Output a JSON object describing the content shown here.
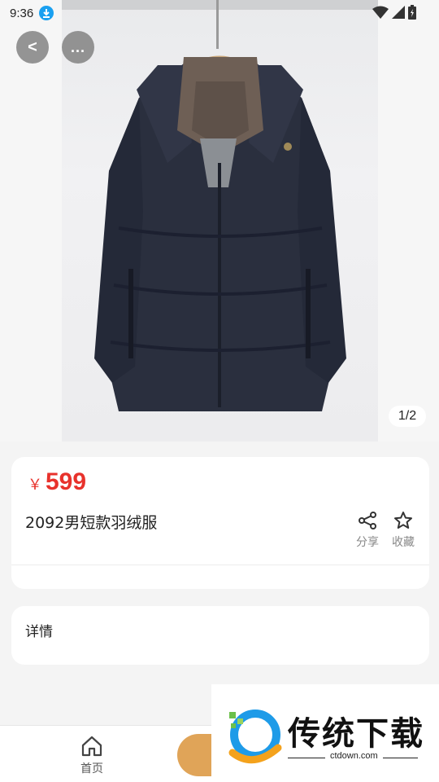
{
  "status_bar": {
    "time": "9:36"
  },
  "gallery": {
    "page_indicator": "1/2"
  },
  "nav": {
    "back_label": "<",
    "more_label": "..."
  },
  "product": {
    "currency": "￥",
    "price": "599",
    "title": "2092男短款羽绒服",
    "share_label": "分享",
    "favorite_label": "收藏"
  },
  "details": {
    "label": "详情"
  },
  "bottom_nav": {
    "home_label": "首页"
  },
  "watermark": {
    "brand": "传统下载",
    "domain": "ctdown.com"
  },
  "colors": {
    "price": "#e8322c",
    "accent_button": "#e0a458",
    "download_badge": "#1aa0f0"
  }
}
